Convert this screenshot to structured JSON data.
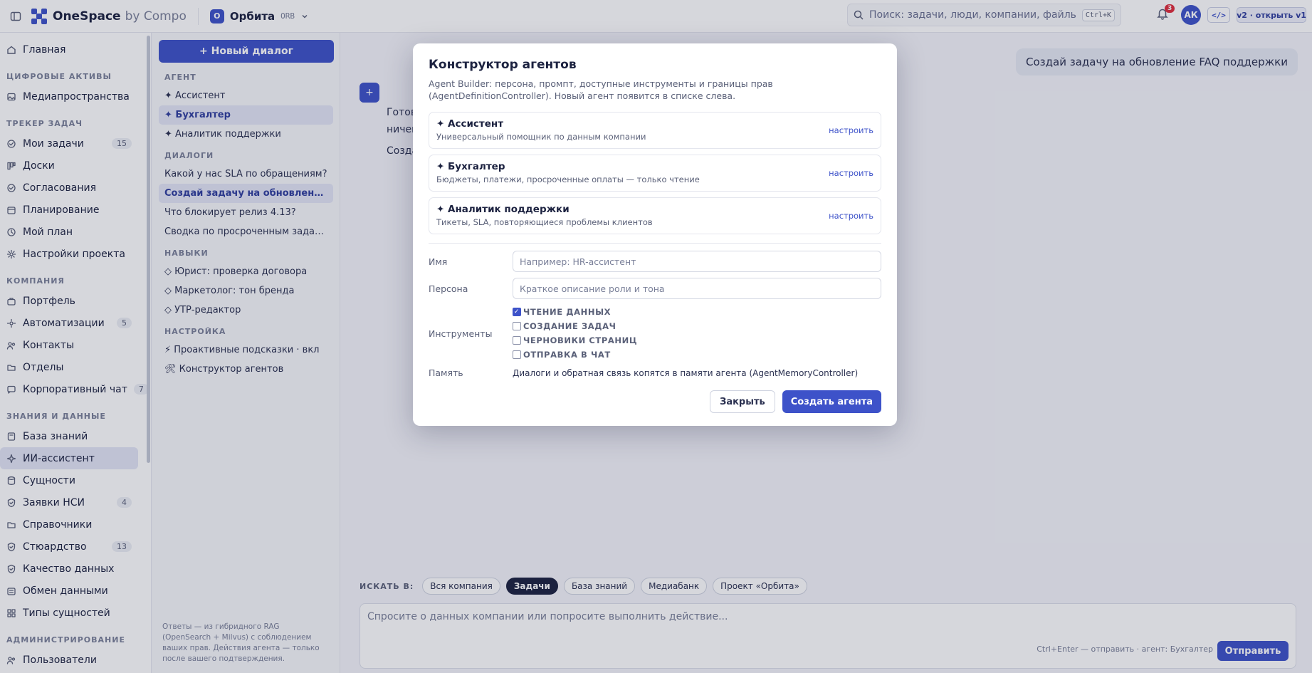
{
  "topbar": {
    "brand": "OneSpace",
    "brand_sub": "by Compo",
    "project_badge": "O",
    "project_name": "Орбита",
    "project_code": "ORB",
    "search_placeholder": "Поиск: задачи, люди, компании, файлы, страниц",
    "search_shortcut": "Ctrl+K",
    "notifications_count": "3",
    "avatar_initials": "АК",
    "dev_button": "</>",
    "version_button": "v2 · открыть v1"
  },
  "nav": {
    "items_top": [
      {
        "label": "Главная",
        "icon": "home-icon"
      }
    ],
    "sections": [
      {
        "title": "ЦИФРОВЫЕ АКТИВЫ",
        "items": [
          {
            "label": "Медиапространства",
            "icon": "image-icon"
          }
        ]
      },
      {
        "title": "ТРЕКЕР ЗАДАЧ",
        "items": [
          {
            "label": "Мои задачи",
            "icon": "check-circle-icon",
            "count": "15"
          },
          {
            "label": "Доски",
            "icon": "board-icon"
          },
          {
            "label": "Согласования",
            "icon": "approval-icon"
          },
          {
            "label": "Планирование",
            "icon": "calendar-icon"
          },
          {
            "label": "Мой план",
            "icon": "clock-icon"
          },
          {
            "label": "Настройки проекта",
            "icon": "gear-icon"
          }
        ]
      },
      {
        "title": "КОМПАНИЯ",
        "items": [
          {
            "label": "Портфель",
            "icon": "briefcase-icon"
          },
          {
            "label": "Автоматизации",
            "icon": "automation-icon",
            "count": "5"
          },
          {
            "label": "Контакты",
            "icon": "contacts-icon"
          },
          {
            "label": "Отделы",
            "icon": "folder-icon"
          },
          {
            "label": "Корпоративный чат",
            "icon": "chat-icon",
            "count": "7"
          }
        ]
      },
      {
        "title": "ЗНАНИЯ И ДАННЫЕ",
        "items": [
          {
            "label": "База знаний",
            "icon": "book-icon"
          },
          {
            "label": "ИИ-ассистент",
            "icon": "sparkle-icon",
            "active": true
          },
          {
            "label": "Сущности",
            "icon": "database-icon"
          },
          {
            "label": "Заявки НСИ",
            "icon": "shield-icon",
            "count": "4"
          },
          {
            "label": "Справочники",
            "icon": "folder-icon"
          },
          {
            "label": "Стюардство",
            "icon": "shield-icon",
            "count": "13"
          },
          {
            "label": "Качество данных",
            "icon": "shield-check-icon"
          },
          {
            "label": "Обмен данными",
            "icon": "exchange-icon"
          },
          {
            "label": "Типы сущностей",
            "icon": "grid-icon"
          }
        ]
      },
      {
        "title": "АДМИНИСТРИРОВАНИЕ",
        "items": [
          {
            "label": "Пользователи",
            "icon": "users-icon"
          }
        ]
      }
    ]
  },
  "chats": {
    "new_dialog": "+ Новый диалог",
    "agents_title": "АГЕНТ",
    "agents": [
      {
        "label": "✦ Ассистент"
      },
      {
        "label": "✦ Бухгалтер",
        "active": true
      },
      {
        "label": "✦ Аналитик поддержки"
      }
    ],
    "dialogs_title": "ДИАЛОГИ",
    "dialogs": [
      {
        "label": "Какой у нас SLA по обращениям?"
      },
      {
        "label": "Создай задачу на обновление FA...",
        "active": true
      },
      {
        "label": "Что блокирует релиз 4.13?"
      },
      {
        "label": "Сводка по просроченным задачам"
      }
    ],
    "skills_title": "НАВЫКИ",
    "skills": [
      {
        "label": "◇ Юрист: проверка договора"
      },
      {
        "label": "◇ Маркетолог: тон бренда"
      },
      {
        "label": "◇ УТР-редактор"
      }
    ],
    "settings_title": "НАСТРОЙКА",
    "settings": [
      {
        "label": "⚡ Проактивные подсказки · вкл"
      },
      {
        "label": "🛠 Конструктор агентов"
      }
    ],
    "footnote": "Ответы — из гибридного RAG (OpenSearch + Milvus) с соблюдением ваших прав. Действия агента — только после вашего подтверждения."
  },
  "main": {
    "user_message": "Создай задачу на обновление FAQ поддержки",
    "bot_line1": "Готов",
    "bot_line2": "ничег",
    "bot_line3": "Созда",
    "scope_label": "ИСКАТЬ В:",
    "scopes": [
      {
        "label": "Вся компания"
      },
      {
        "label": "Задачи",
        "active": true
      },
      {
        "label": "База знаний"
      },
      {
        "label": "Медиабанк"
      },
      {
        "label": "Проект «Орбита»"
      }
    ],
    "composer_placeholder": "Спросите о данных компании или попросите выполнить действие...",
    "composer_hint": "Ctrl+Enter — отправить · агент: Бухгалтер",
    "send": "Отправить"
  },
  "modal": {
    "title": "Конструктор агентов",
    "description": "Agent Builder: персона, промпт, доступные инструменты и границы прав (AgentDefinitionController). Новый агент появится в списке слева.",
    "agents": [
      {
        "name": "✦ Ассистент",
        "desc": "Универсальный помощник по данным компании",
        "action": "настроить"
      },
      {
        "name": "✦ Бухгалтер",
        "desc": "Бюджеты, платежи, просроченные оплаты — только чтение",
        "action": "настроить"
      },
      {
        "name": "✦ Аналитик поддержки",
        "desc": "Тикеты, SLA, повторяющиеся проблемы клиентов",
        "action": "настроить"
      }
    ],
    "name_label": "Имя",
    "name_placeholder": "Например: HR-ассистент",
    "persona_label": "Персона",
    "persona_placeholder": "Краткое описание роли и тона",
    "tools_label": "Инструменты",
    "tools": [
      {
        "label": "ЧТЕНИЕ ДАННЫХ",
        "checked": true
      },
      {
        "label": "СОЗДАНИЕ ЗАДАЧ",
        "checked": false
      },
      {
        "label": "ЧЕРНОВИКИ СТРАНИЦ",
        "checked": false
      },
      {
        "label": "ОТПРАВКА В ЧАТ",
        "checked": false
      }
    ],
    "memory_label": "Память",
    "memory_text": "Диалоги и обратная связь копятся в памяти агента (AgentMemoryController)",
    "close": "Закрыть",
    "create": "Создать агента"
  },
  "colors": {
    "accent": "#3d52c9",
    "danger": "#e02d3c"
  }
}
